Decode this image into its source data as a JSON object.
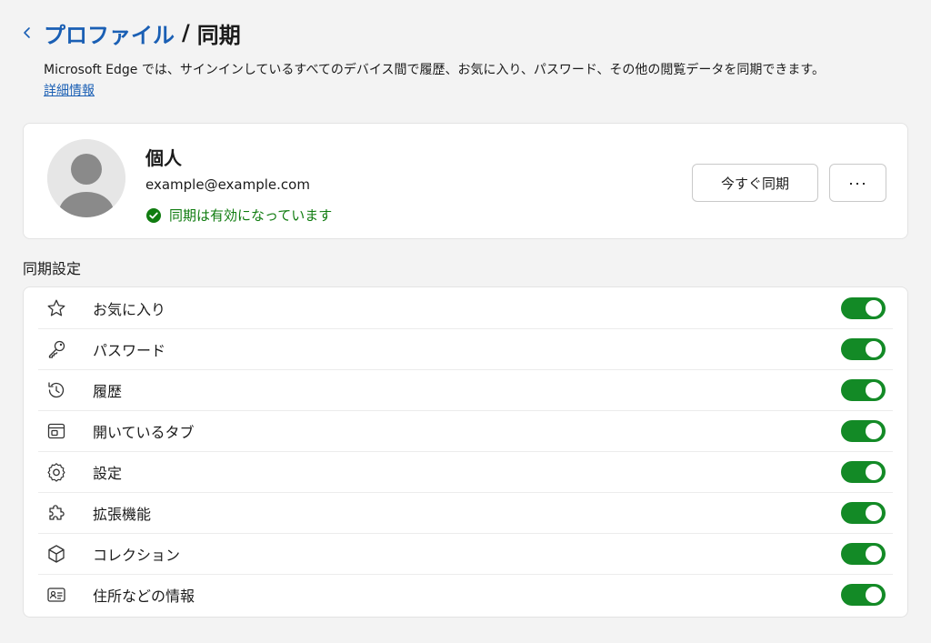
{
  "header": {
    "breadcrumb_parent": "プロファイル",
    "separator": "/",
    "current": "同期"
  },
  "description": "Microsoft Edge では、サインインしているすべてのデバイス間で履歴、お気に入り、パスワード、その他の閲覧データを同期できます。",
  "learn_more": "詳細情報",
  "profile": {
    "name": "個人",
    "email": "example@example.com",
    "status": "同期は有効になっています",
    "sync_now_label": "今すぐ同期",
    "more_label": "···"
  },
  "section_title": "同期設定",
  "items": [
    {
      "label": "お気に入り",
      "icon": "star-icon",
      "enabled": true
    },
    {
      "label": "パスワード",
      "icon": "key-icon",
      "enabled": true
    },
    {
      "label": "履歴",
      "icon": "history-icon",
      "enabled": true
    },
    {
      "label": "開いているタブ",
      "icon": "tabs-icon",
      "enabled": true
    },
    {
      "label": "設定",
      "icon": "gear-icon",
      "enabled": true
    },
    {
      "label": "拡張機能",
      "icon": "puzzle-icon",
      "enabled": true
    },
    {
      "label": "コレクション",
      "icon": "collection-icon",
      "enabled": true
    },
    {
      "label": "住所などの情報",
      "icon": "contact-card-icon",
      "enabled": true
    }
  ],
  "colors": {
    "link": "#1a5fb4",
    "status_green": "#107c10",
    "toggle_on": "#138a26",
    "background": "#f3f3f3"
  }
}
